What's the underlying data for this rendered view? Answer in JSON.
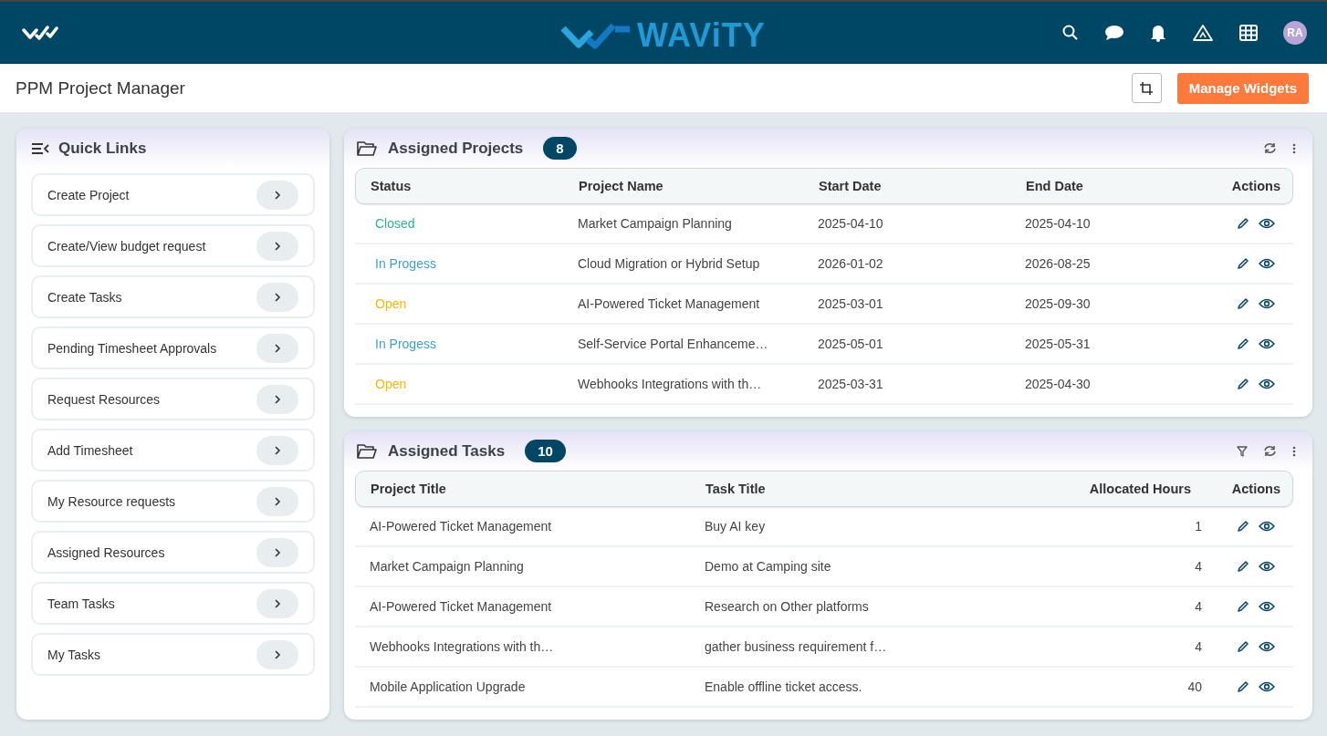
{
  "topbar": {
    "brand": "WAViTY",
    "avatar": "RA"
  },
  "page": {
    "title": "PPM Project Manager",
    "manage_button": "Manage Widgets"
  },
  "quick_links": {
    "title": "Quick Links",
    "items": [
      "Create Project",
      "Create/View budget request",
      "Create Tasks",
      "Pending Timesheet Approvals",
      "Request Resources",
      "Add Timesheet",
      "My Resource requests",
      "Assigned Resources",
      "Team Tasks",
      "My Tasks"
    ]
  },
  "assigned_projects": {
    "title": "Assigned Projects",
    "count": "8",
    "columns": [
      "Status",
      "Project Name",
      "Start Date",
      "End Date",
      "Actions"
    ],
    "rows": [
      {
        "status": "Closed",
        "color": "#2bb39a",
        "name": "Market Campaign Planning",
        "start": "2025-04-10",
        "end": "2025-04-10"
      },
      {
        "status": "In Progess",
        "color": "#3a9fd6",
        "name": "Cloud Migration or Hybrid Setup",
        "start": "2026-01-02",
        "end": "2026-08-25"
      },
      {
        "status": "Open",
        "color": "#f5b800",
        "name": "AI-Powered Ticket Management",
        "start": "2025-03-01",
        "end": "2025-09-30"
      },
      {
        "status": "In Progess",
        "color": "#3a9fd6",
        "name": "Self-Service Portal Enhanceme…",
        "start": "2025-05-01",
        "end": "2025-05-31"
      },
      {
        "status": "Open",
        "color": "#f5b800",
        "name": "Webhooks Integrations with th…",
        "start": "2025-03-31",
        "end": "2025-04-30"
      }
    ]
  },
  "assigned_tasks": {
    "title": "Assigned Tasks",
    "count": "10",
    "columns": [
      "Project Title",
      "Task Title",
      "Allocated Hours",
      "Actions"
    ],
    "rows": [
      {
        "project": "AI-Powered Ticket Management",
        "task": "Buy AI key",
        "hours": "1"
      },
      {
        "project": "Market Campaign Planning",
        "task": "Demo at Camping site",
        "hours": "4"
      },
      {
        "project": "AI-Powered Ticket Management",
        "task": "Research on Other platforms",
        "hours": "4"
      },
      {
        "project": "Webhooks Integrations with th…",
        "task": "gather business requirement f…",
        "hours": "4"
      },
      {
        "project": "Mobile Application Upgrade",
        "task": "Enable offline ticket access.",
        "hours": "40"
      }
    ]
  }
}
